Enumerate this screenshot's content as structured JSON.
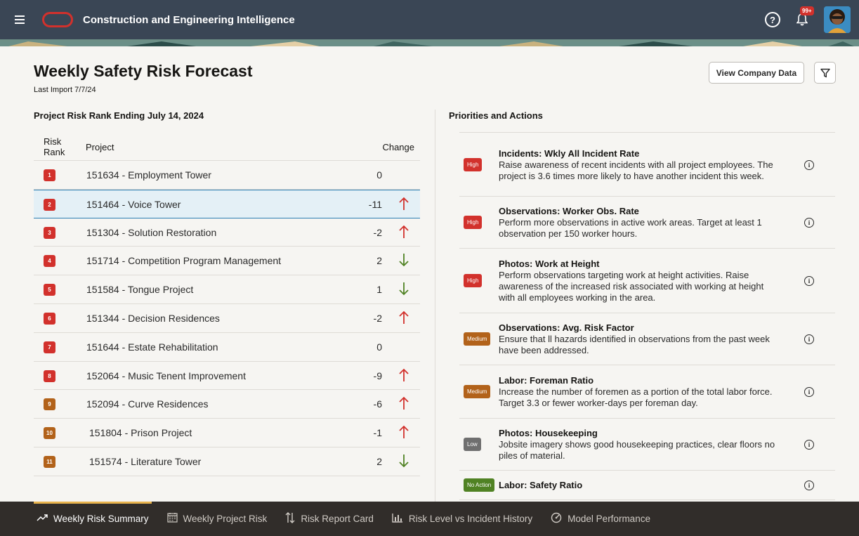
{
  "header": {
    "app_title": "Construction and Engineering Intelligence",
    "menu_icon": "hamburger-icon",
    "notification_count": "99+"
  },
  "page": {
    "title": "Weekly Safety Risk Forecast",
    "last_import": "Last Import 7/7/24",
    "view_company_label": "View Company Data"
  },
  "risk_rank": {
    "section_title": "Project Risk Rank Ending July 14, 2024",
    "col_rank": "Risk Rank",
    "col_project": "Project",
    "col_change": "Change",
    "rows": [
      {
        "rank": "1",
        "project": "151634 - Employment Tower",
        "change": "0",
        "direction": "none",
        "color": "#d2312c"
      },
      {
        "rank": "2",
        "project": "151464 - Voice Tower",
        "change": "-11",
        "direction": "up",
        "color": "#d2312c"
      },
      {
        "rank": "3",
        "project": "151304 - Solution Restoration",
        "change": "-2",
        "direction": "up",
        "color": "#d2312c"
      },
      {
        "rank": "4",
        "project": "151714 - Competition Program Management",
        "change": "2",
        "direction": "down",
        "color": "#d2312c"
      },
      {
        "rank": "5",
        "project": "151584 - Tongue Project",
        "change": "1",
        "direction": "down",
        "color": "#d2312c"
      },
      {
        "rank": "6",
        "project": "151344 - Decision Residences",
        "change": "-2",
        "direction": "up",
        "color": "#d2312c"
      },
      {
        "rank": "7",
        "project": "151644 - Estate Rehabilitation",
        "change": "0",
        "direction": "none",
        "color": "#d2312c"
      },
      {
        "rank": "8",
        "project": "152064 - Music Tenent Improvement",
        "change": "-9",
        "direction": "up",
        "color": "#d2312c"
      },
      {
        "rank": "9",
        "project": "152094 - Curve Residences",
        "change": "-6",
        "direction": "up",
        "color": "#b2621a"
      },
      {
        "rank": "10",
        "project": "151804 - Prison Project",
        "change": "-1",
        "direction": "up",
        "color": "#b2621a"
      },
      {
        "rank": "11",
        "project": "151574 - Literature Tower",
        "change": "2",
        "direction": "down",
        "color": "#b2621a"
      }
    ]
  },
  "priorities": {
    "section_title": "Priorities and Actions",
    "items": [
      {
        "level": "High",
        "color": "#d2312c",
        "title": "Incidents: Wkly All Incident Rate",
        "text": "Raise awareness of recent incidents with all project employees. The project is 3.6 times more likely to have another incident this week."
      },
      {
        "level": "High",
        "color": "#d2312c",
        "title": "Observations: Worker Obs. Rate",
        "text": "Perform more observations in active work areas. Target at least 1 observation per 150 worker hours."
      },
      {
        "level": "High",
        "color": "#d2312c",
        "title": "Photos: Work at Height",
        "text": "Perform observations targeting work at height activities. Raise awareness of the increased risk associated with working at height with all employees working in the area."
      },
      {
        "level": "Medium",
        "color": "#b2621a",
        "title": "Observations: Avg. Risk Factor",
        "text": "Ensure that ll hazards identified in observations from the past week have been addressed."
      },
      {
        "level": "Medium",
        "color": "#b2621a",
        "title": "Labor: Foreman Ratio",
        "text": "Increase the number of foremen as a portion of the total labor force. Target 3.3 or fewer worker-days per foreman day."
      },
      {
        "level": "Low",
        "color": "#6f6f6f",
        "title": "Photos: Housekeeping",
        "text": "Jobsite imagery shows good housekeeping practices, clear floors no piles of material."
      },
      {
        "level": "No Action",
        "color": "#508223",
        "title": "Labor: Safety Ratio",
        "text": ""
      }
    ]
  },
  "bottom_nav": {
    "tabs": [
      {
        "label": "Weekly Risk Summary",
        "icon": "trend-up-icon",
        "active": true
      },
      {
        "label": "Weekly Project Risk",
        "icon": "calendar-icon",
        "active": false
      },
      {
        "label": "Risk Report Card",
        "icon": "sort-arrows-icon",
        "active": false
      },
      {
        "label": "Risk Level vs Incident History",
        "icon": "bar-chart-icon",
        "active": false
      },
      {
        "label": "Model Performance",
        "icon": "gauge-icon",
        "active": false
      }
    ]
  }
}
